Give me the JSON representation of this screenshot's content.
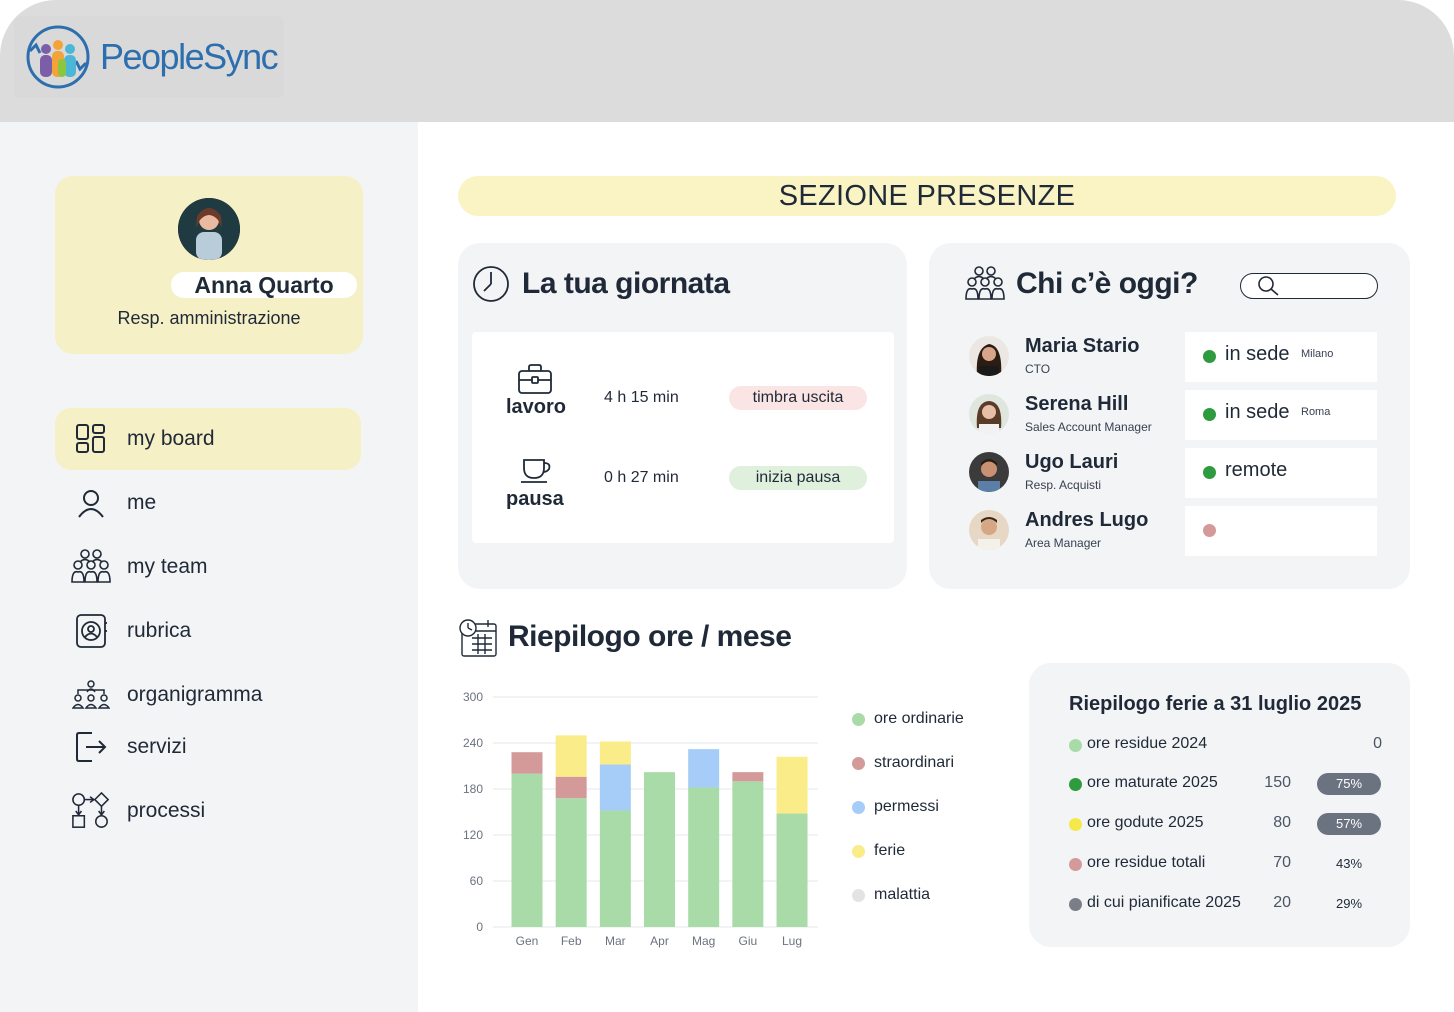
{
  "brand": {
    "name": "PeopleSync"
  },
  "profile": {
    "name": "Anna Quarto",
    "role": "Resp. amministrazione"
  },
  "nav": [
    {
      "label": "my board",
      "icon": "dashboard-icon",
      "active": true
    },
    {
      "label": "me",
      "icon": "user-icon",
      "active": false
    },
    {
      "label": "my team",
      "icon": "team-icon",
      "active": false
    },
    {
      "label": "rubrica",
      "icon": "address-book-icon",
      "active": false
    },
    {
      "label": "organigramma",
      "icon": "org-chart-icon",
      "active": false
    },
    {
      "label": "servizi",
      "icon": "exit-icon",
      "active": false
    },
    {
      "label": "processi",
      "icon": "process-icon",
      "active": false
    }
  ],
  "section": {
    "title": "SEZIONE PRESENZE"
  },
  "day": {
    "title": "La tua giornata",
    "rows": [
      {
        "label": "lavoro",
        "icon": "briefcase-icon",
        "time": "4 h 15 min",
        "action": "timbra uscita",
        "action_color": "#fbe4e4"
      },
      {
        "label": "pausa",
        "icon": "coffee-cup-icon",
        "time": "0 h 27 min",
        "action": "inizia pausa",
        "action_color": "#dff0dd"
      }
    ]
  },
  "presence": {
    "title": "Chi c’è oggi?",
    "search": {
      "placeholder": ""
    },
    "people": [
      {
        "name": "Maria Stario",
        "role": "CTO",
        "status": "in sede",
        "location": "Milano",
        "status_color": "#2e9b3e"
      },
      {
        "name": "Serena Hill",
        "role": "Sales Account Manager",
        "status": "in sede",
        "location": "Roma",
        "status_color": "#2e9b3e"
      },
      {
        "name": "Ugo Lauri",
        "role": "Resp. Acquisti",
        "status": "remote",
        "location": "",
        "status_color": "#2e9b3e"
      },
      {
        "name": "Andres Lugo",
        "role": "Area Manager",
        "status": "",
        "location": "",
        "status_color": "#d49a9a"
      }
    ]
  },
  "summary": {
    "title": "Riepilogo ore / mese"
  },
  "chart_data": {
    "type": "bar",
    "stacked": true,
    "categories": [
      "Gen",
      "Feb",
      "Mar",
      "Apr",
      "Mag",
      "Giu",
      "Lug"
    ],
    "ylim": [
      0,
      300
    ],
    "yticks": [
      0,
      60,
      120,
      180,
      240,
      300
    ],
    "grid": true,
    "legend_position": "right",
    "series": [
      {
        "name": "ore ordinarie",
        "color": "#a8dba8",
        "values": [
          200,
          168,
          152,
          202,
          182,
          190,
          148
        ]
      },
      {
        "name": "straordinari",
        "color": "#d49a9a",
        "values": [
          28,
          28,
          0,
          0,
          0,
          12,
          0
        ]
      },
      {
        "name": "permessi",
        "color": "#a5cdf7",
        "values": [
          0,
          0,
          60,
          0,
          50,
          0,
          0
        ]
      },
      {
        "name": "ferie",
        "color": "#fbec8a",
        "values": [
          0,
          54,
          30,
          0,
          0,
          0,
          74
        ]
      },
      {
        "name": "malattia",
        "color": "#e3e3e3",
        "values": [
          0,
          0,
          0,
          0,
          0,
          0,
          0
        ]
      }
    ]
  },
  "ferie": {
    "title": "Riepilogo ferie a 31 luglio 2025",
    "rows": [
      {
        "label": "ore residue 2024",
        "value": "0",
        "pct": "",
        "color": "#a8dba8",
        "filled": false
      },
      {
        "label": "ore maturate 2025",
        "value": "150",
        "pct": "75%",
        "color": "#2e9b3e",
        "filled": true
      },
      {
        "label": "ore godute 2025",
        "value": "80",
        "pct": "57%",
        "color": "#f5e84a",
        "filled": true
      },
      {
        "label": "ore residue totali",
        "value": "70",
        "pct": "43%",
        "color": "#d49a9a",
        "filled": false
      },
      {
        "label": "di cui pianificate 2025",
        "value": "20",
        "pct": "29%",
        "color": "#7a7f87",
        "filled": false
      }
    ]
  }
}
